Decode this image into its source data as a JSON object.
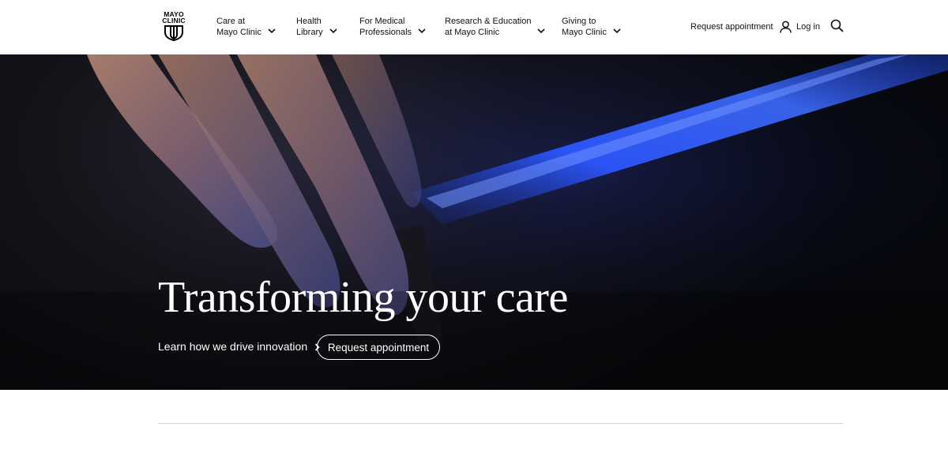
{
  "logo": {
    "line1": "MAYO",
    "line2": "CLINIC",
    "icon": "mayo-shield-icon"
  },
  "nav": {
    "items": [
      {
        "line1": "Care at",
        "line2": "Mayo Clinic"
      },
      {
        "line1": "Health",
        "line2": "Library"
      },
      {
        "line1": "For Medical",
        "line2": "Professionals"
      },
      {
        "line1": "Research & Education",
        "line2": "at Mayo Clinic"
      },
      {
        "line1": "Giving to",
        "line2": "Mayo Clinic"
      }
    ],
    "chevron_icon": "chevron-down-icon"
  },
  "utility": {
    "request_label": "Request appointment",
    "login_label": "Log in",
    "login_icon": "user-icon",
    "search_icon": "search-icon"
  },
  "hero": {
    "title": "Transforming your care",
    "link_label": "Learn how we drive innovation",
    "link_icon": "chevron-right-icon",
    "button_label": "Request appointment"
  },
  "colors": {
    "header_bg": "#ffffff",
    "hero_bg": "#0b0b0e",
    "hero_accent": "#2f5bff",
    "text_on_dark": "#ffffff"
  }
}
